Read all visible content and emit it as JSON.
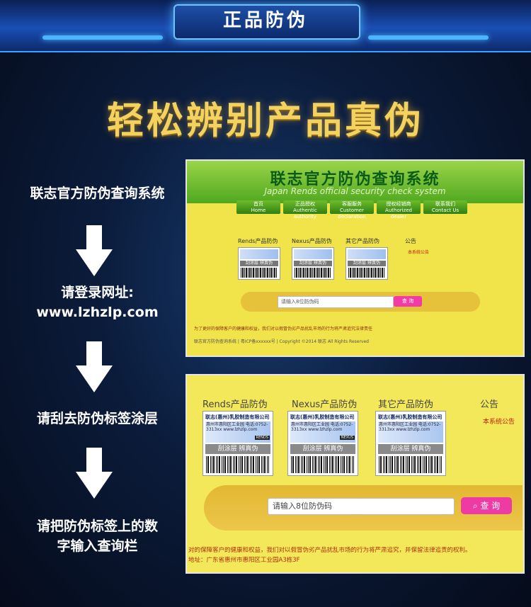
{
  "banner": {
    "title": "正品防伪"
  },
  "headline": "轻松辨别产品真伪",
  "steps": [
    "联志官方防伪查询系统",
    "请登录网址:",
    "www.lzhzlp.com",
    "请刮去防伪标签涂层",
    "请把防伪标签上的数",
    "字输入查询栏"
  ],
  "shot1": {
    "title": "联志官方防伪查询系统",
    "subtitle": "Japan Rends official security check system",
    "nav": [
      {
        "cn": "首页",
        "en": "Home"
      },
      {
        "cn": "正品授权",
        "en": "Authentic authority"
      },
      {
        "cn": "客服服务",
        "en": "Customer declaration"
      },
      {
        "cn": "授权经销商",
        "en": "Authorized dealer"
      },
      {
        "cn": "联系我们",
        "en": "Contact Us"
      }
    ],
    "products": [
      "Rends产品防伪",
      "Nexus产品防伪",
      "其它产品防伪"
    ],
    "notice_title": "公告",
    "notice_item": "本系统公告",
    "tag_scratch": "刮涂层 辨真伪",
    "input_placeholder": "请输入8位防伪码",
    "search_btn": "查 询",
    "footer_line1": "为了更好的保障客户的健康和权益，我们对以假冒伪劣产品扰乱市场的行为将严肃追究法律责任",
    "footer_line2": "联志官方防伪查询系统 | 粤ICP备xxxxxx号 | Copyright ©2014 联志 All Rights Reserved"
  },
  "shot2": {
    "products": [
      "Rends产品防伪",
      "Nexus产品防伪",
      "其它产品防伪"
    ],
    "notice_title": "公告",
    "notice_item": "本系统公告",
    "tag_company": "联志(惠州)乳胶制造有限公司",
    "tag_body": "惠州市惠阳区工业园 电话:0752-3313xx www.lzhzlp.com",
    "tag_scratch": "刮涂层 辨真伪",
    "brand_tags": [
      "RENDS",
      "NEXUS"
    ],
    "input_placeholder": "请输入8位防伪码",
    "search_btn": "查 询",
    "footer_line1": "对的保障客户的健康和权益，我们对以假冒伪劣产品扰乱市场的行为将严肃追究，并保留法律追责的权利。",
    "footer_line2": "地址：广东省惠州市惠阳区工业园A3栋3F"
  }
}
